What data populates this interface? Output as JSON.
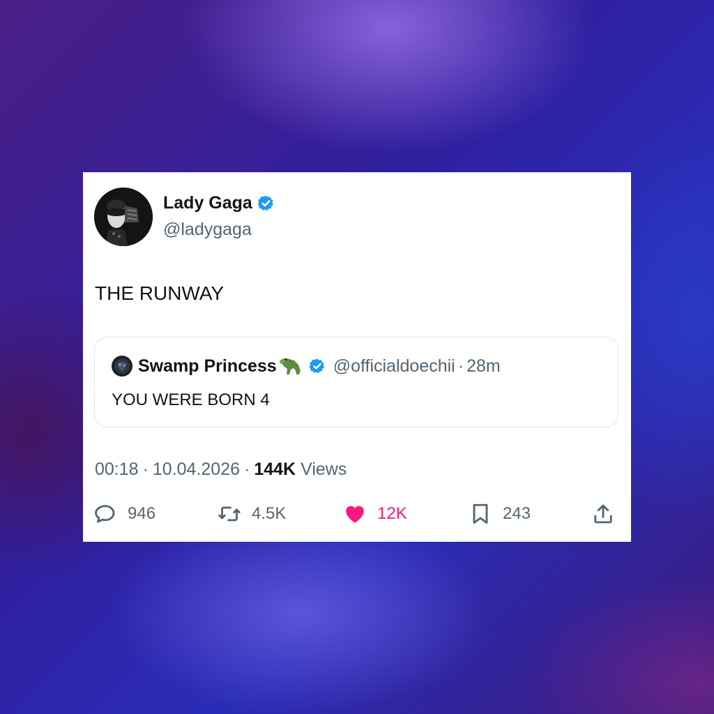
{
  "colors": {
    "verified_blue": "#1d9bf0",
    "like_pink": "#f91880",
    "text_primary": "#0f1419",
    "text_secondary": "#536471"
  },
  "tweet": {
    "author": {
      "display_name": "Lady Gaga",
      "handle": "@ladygaga",
      "verified": true,
      "avatar_icon": "avatar-photo"
    },
    "text": "THE RUNWAY",
    "quote": {
      "display_name": "Swamp Princess",
      "name_emoji_icon": "alligator-icon",
      "handle": "@officialdoechii",
      "separator": "·",
      "time_ago": "28m",
      "text": "YOU WERE BORN 4"
    },
    "meta": {
      "time": "00:18",
      "separator": "·",
      "date": "10.04.2026",
      "views_count": "144K",
      "views_label": "Views"
    },
    "actions": {
      "replies": "946",
      "reposts": "4.5K",
      "likes": "12K",
      "bookmarks": "243"
    }
  }
}
